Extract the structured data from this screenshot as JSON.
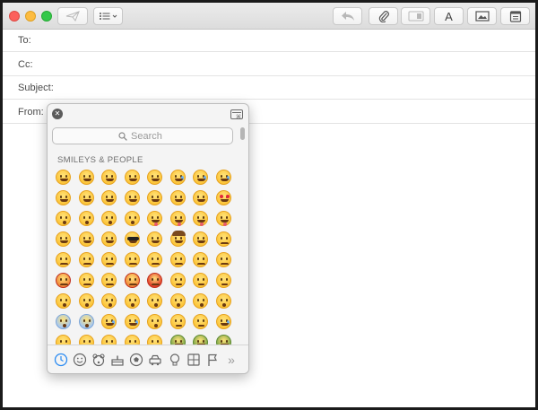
{
  "compose": {
    "fields": {
      "to_label": "To:",
      "cc_label": "Cc:",
      "subject_label": "Subject:",
      "from_label": "From:"
    }
  },
  "toolbar": {
    "buttons": [
      "send-icon",
      "list-format-icon",
      "reply-icon",
      "paperclip-icon",
      "markup-icon",
      "font-icon",
      "photo-icon",
      "calendar-icon"
    ],
    "font_button_label": "A"
  },
  "emoji_picker": {
    "search_placeholder": "Search",
    "section_title": "SMILEYS & PEOPLE",
    "categories": [
      "recent-clock-icon",
      "smiley-face-icon",
      "animal-bear-icon",
      "food-cake-icon",
      "ball-activity-icon",
      "car-travel-icon",
      "lightbulb-objects-icon",
      "symbols-grid-icon",
      "flag-icon",
      "more-chevrons-icon"
    ],
    "more_label": "»",
    "colors": {
      "face": "#fcc53a",
      "face_edge": "#e6a321",
      "accent_blue": "#2a8bf2",
      "red_face": "#e2402c",
      "purple_devil": "#8b3fb8",
      "green_sick": "#7fa84a"
    }
  }
}
